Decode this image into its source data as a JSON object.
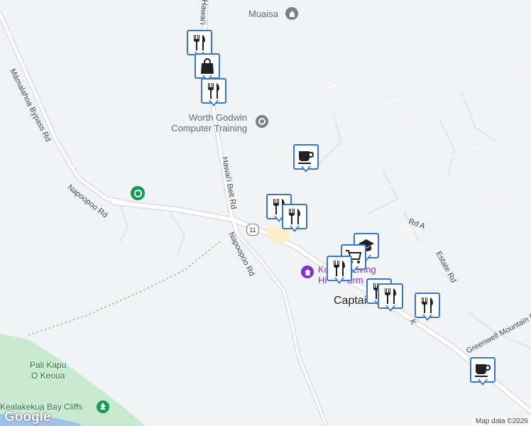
{
  "map": {
    "roads": {
      "mamalahoa": "Māmalahoa Bypass Rd",
      "napoopoo_left": "Napoopoo Rd",
      "napoopoo_right": "Napoopoo Rd",
      "napoopoo_top": "Napoopoo Rd",
      "hawaii_belt": "Hawaiʻi Belt Rd",
      "hawaii_belt_top": "Hawaiʻi",
      "route_shield": "11",
      "rd_a": "Rd A",
      "estate": "Estate Rd",
      "greenwell": "Greenwell Mountain Rd",
      "kr": "K"
    },
    "places": {
      "muaisa": "Muaisa",
      "worth_godwin_line1": "Worth Godwin",
      "worth_godwin_line2": "Computer Training",
      "kona_line1": "Ko    ce Living",
      "kona_line2": "Hi        arm",
      "captain": "Captai      k",
      "pali_line1": "Pali Kapu",
      "pali_line2": "O Keoua",
      "kealakekua": "Kealakekua Bay Cliffs"
    },
    "markers": [
      {
        "type": "restaurant-icon"
      },
      {
        "type": "shopping-bag-icon"
      },
      {
        "type": "restaurant-icon"
      },
      {
        "type": "coffee-cup-icon"
      },
      {
        "type": "restaurant-icon"
      },
      {
        "type": "restaurant-icon"
      },
      {
        "type": "school-icon"
      },
      {
        "type": "cart-icon"
      },
      {
        "type": "restaurant-icon"
      },
      {
        "type": "restaurant-icon"
      },
      {
        "type": "restaurant-icon"
      },
      {
        "type": "restaurant-icon"
      },
      {
        "type": "coffee-cup-icon"
      }
    ],
    "colors": {
      "background": "#f1f3f4",
      "road": "#ffffff",
      "road_major": "#dadce0",
      "park": "#c9ead0",
      "water": "#9ec2ea",
      "marker_border": "#3b78c4",
      "purple": "#8430ce",
      "green_poi": "#0f9d58"
    },
    "attribution": "Map data ©2026",
    "logo": "Google"
  }
}
